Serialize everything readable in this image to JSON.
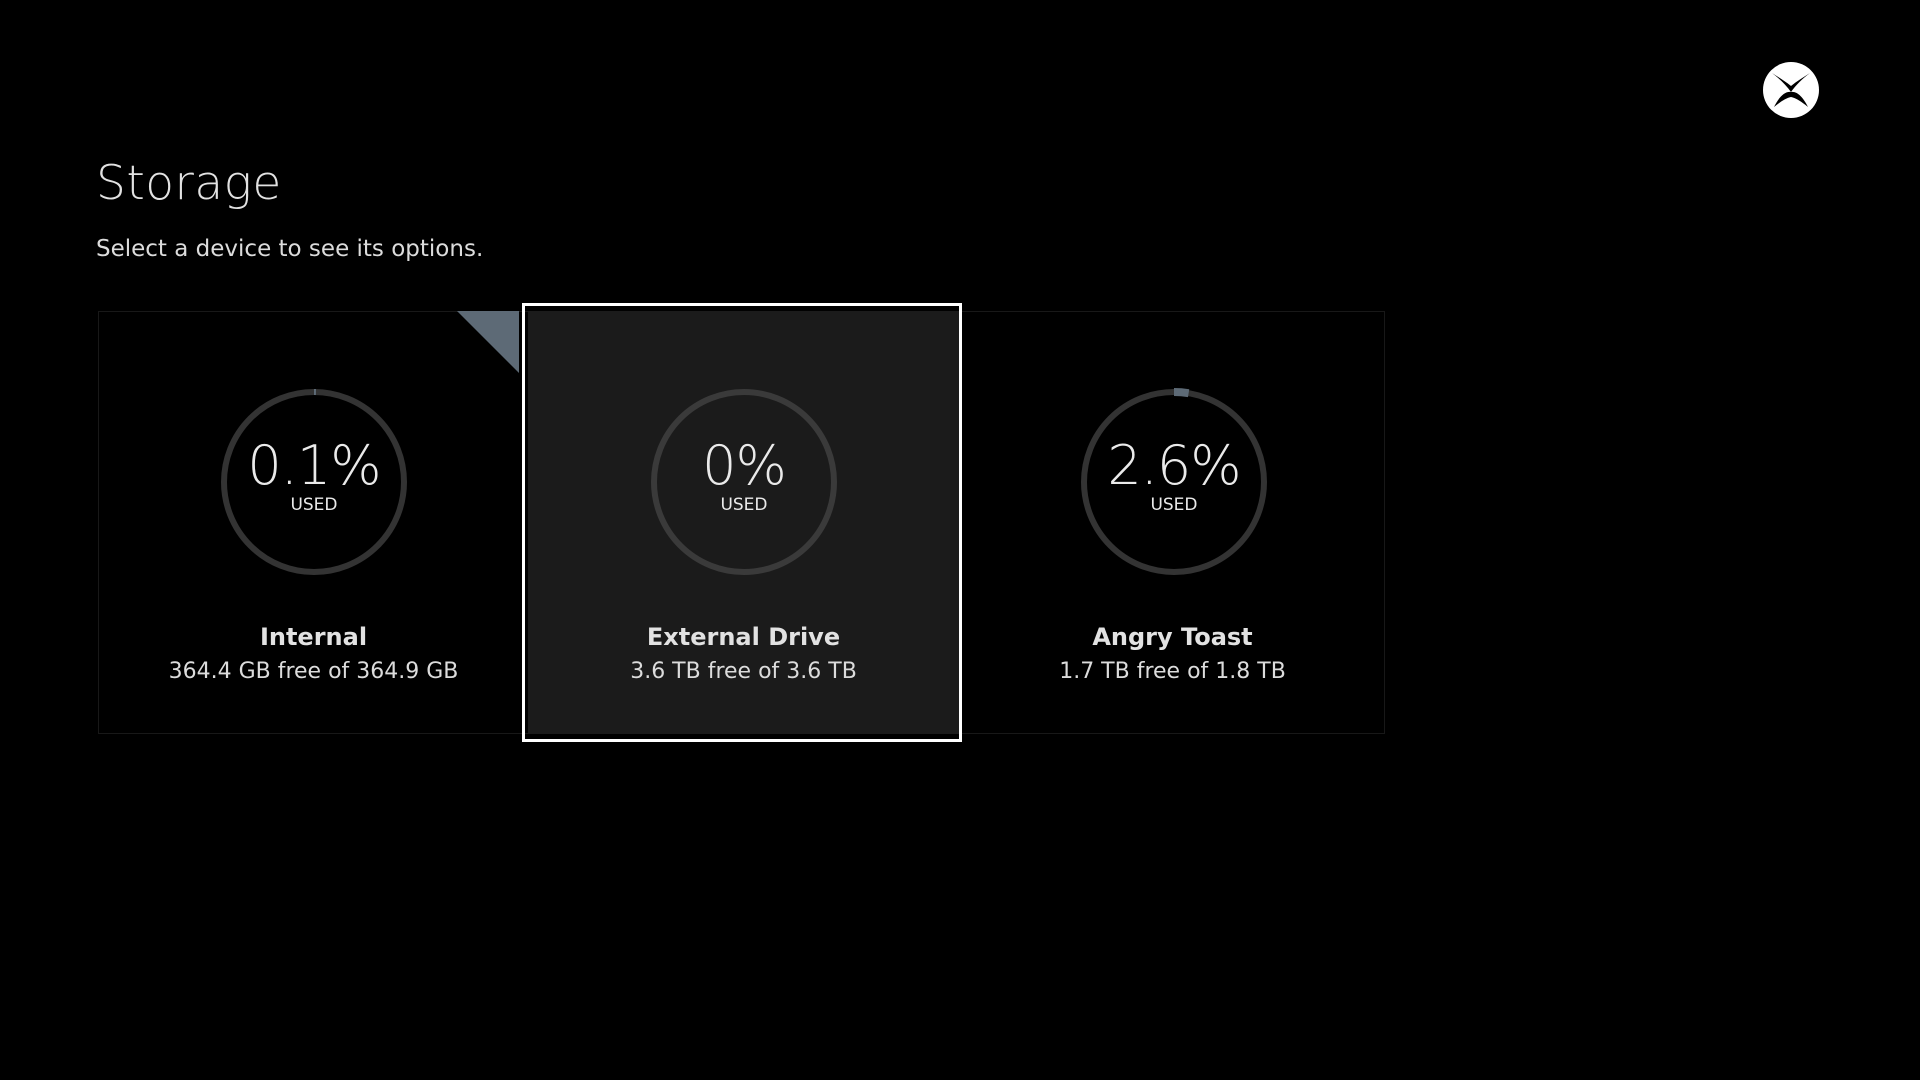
{
  "header": {
    "title": "Storage",
    "subtitle": "Select a device to see its options.",
    "logo_icon": "xbox-logo-icon"
  },
  "devices": [
    {
      "name": "Internal",
      "free_text": "364.4 GB free of 364.9 GB",
      "percent_label": "0.1%",
      "used_label": "USED",
      "used_fraction": 0.001
    },
    {
      "name": "External Drive",
      "free_text": "3.6 TB free of 3.6 TB",
      "percent_label": "0%",
      "used_label": "USED",
      "used_fraction": 0.0
    },
    {
      "name": "Angry Toast",
      "free_text": "1.7 TB free of 1.8 TB",
      "percent_label": "2.6%",
      "used_label": "USED",
      "used_fraction": 0.026
    }
  ],
  "colors": {
    "ring_track": "#333333",
    "ring_fill": "#5d6a76",
    "focus": "#ffffff",
    "selected_tile": "#1b1b1b"
  }
}
